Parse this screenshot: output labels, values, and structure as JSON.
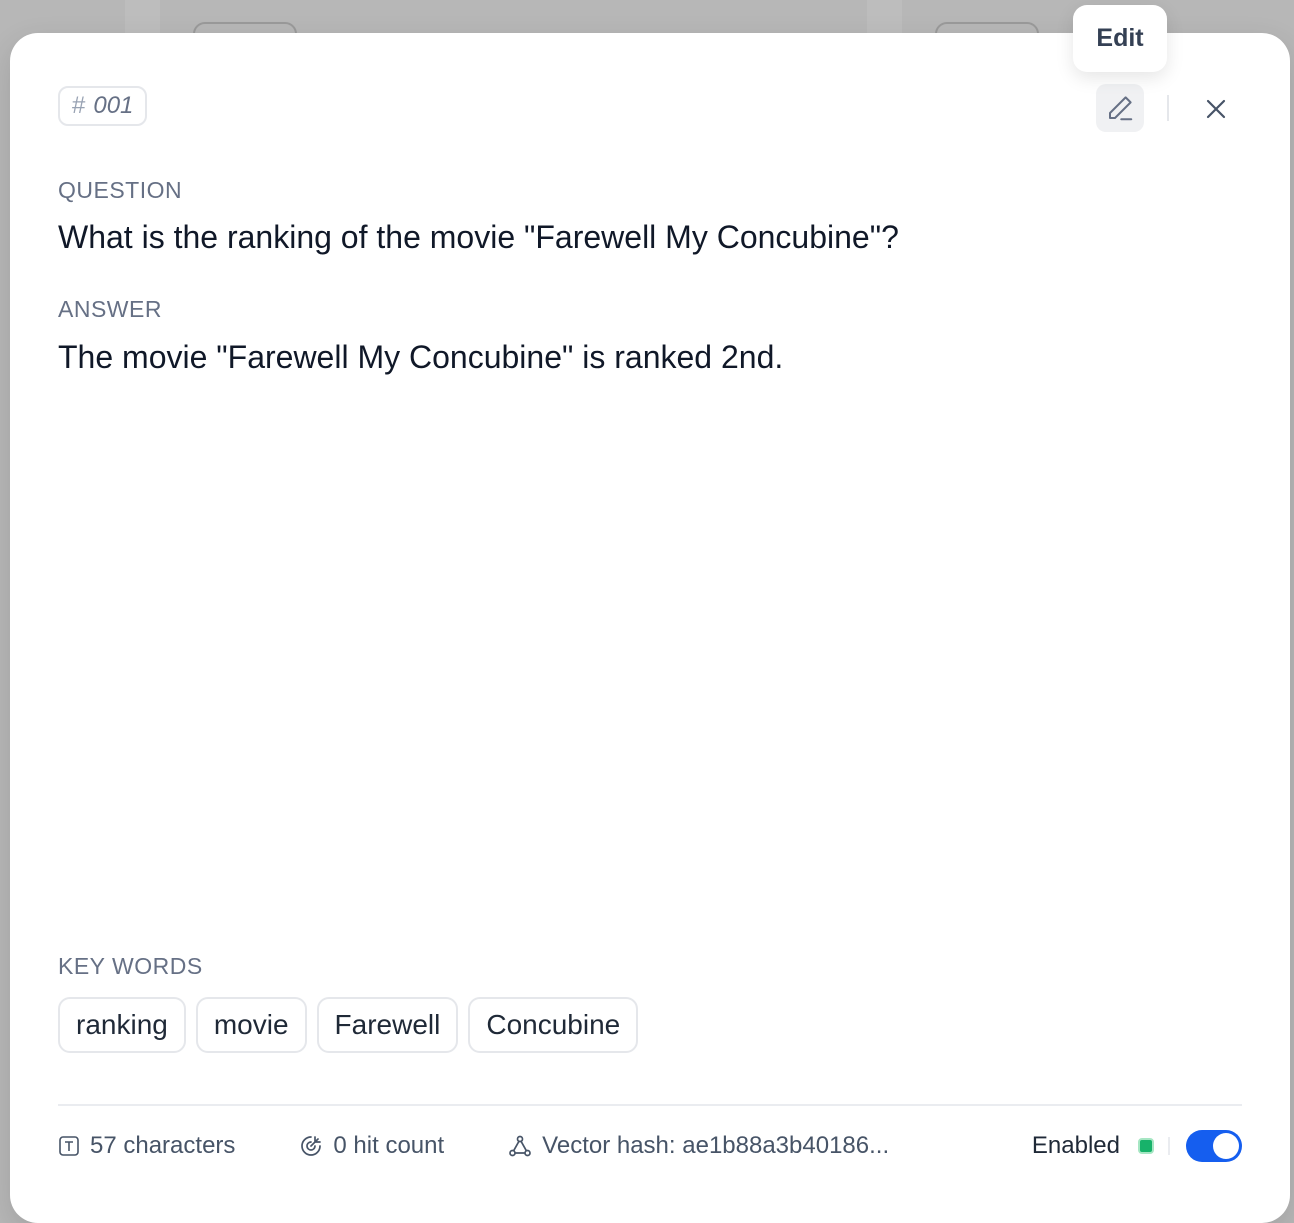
{
  "item": {
    "id": "001"
  },
  "question": {
    "label": "QUESTION",
    "text": "What is the ranking of the movie \"Farewell My Concubine\"?"
  },
  "answer": {
    "label": "ANSWER",
    "text": "The movie \"Farewell My Concubine\" is ranked 2nd."
  },
  "keywords": {
    "label": "KEY WORDS",
    "items": [
      "ranking",
      "movie",
      "Farewell",
      "Concubine"
    ]
  },
  "footer": {
    "characters": "57 characters",
    "hit_count": "0 hit count",
    "vector_hash": "Vector hash: ae1b88a3b40186...",
    "status": "Enabled",
    "enabled": true
  },
  "tooltip": {
    "text": "Edit"
  },
  "colors": {
    "accent": "#155eef",
    "status_green": "#17b26a"
  },
  "icons": {
    "edit": "pencil-icon",
    "close": "close-icon",
    "chars": "text-icon",
    "hits": "target-icon",
    "hash": "vector-icon"
  }
}
